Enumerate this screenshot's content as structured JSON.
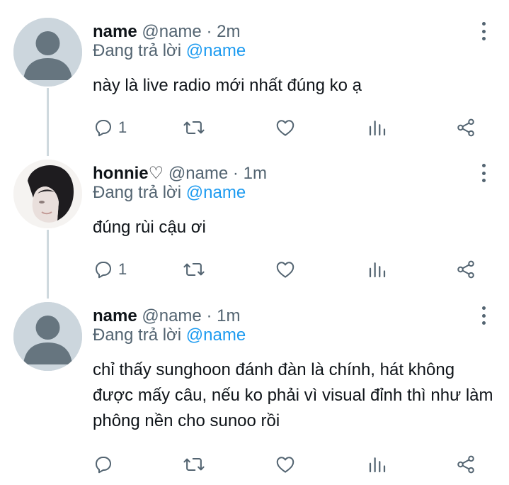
{
  "tweets": [
    {
      "avatar": "default-avatar",
      "author": "name",
      "handle": "@name",
      "separator": "·",
      "time": "2m",
      "reply_prefix": "Đang trả lời",
      "reply_to": "@name",
      "text": "này là live radio mới nhất đúng ko ạ",
      "reply_count": "1"
    },
    {
      "avatar": "profile-photo",
      "author": "honnie♡",
      "handle": "@name",
      "separator": "·",
      "time": "1m",
      "reply_prefix": "Đang trả lời",
      "reply_to": "@name",
      "text": "đúng rùi cậu ơi",
      "reply_count": "1"
    },
    {
      "avatar": "default-avatar",
      "author": "name",
      "handle": "@name",
      "separator": "·",
      "time": "1m",
      "reply_prefix": "Đang trả lời",
      "reply_to": "@name",
      "text": "chỉ thấy sunghoon đánh đàn là chính, hát không được mấy câu, nếu ko phải vì visual đỉnh thì như làm phông nền cho sunoo rồi",
      "reply_count": ""
    }
  ],
  "icons": [
    "more-icon",
    "reply-icon",
    "retweet-icon",
    "like-icon",
    "views-icon",
    "share-icon"
  ],
  "colors": {
    "accent": "#1d9bf0",
    "muted": "#536471",
    "text": "#0f1419",
    "avatar_bg": "#ccd6dd"
  }
}
